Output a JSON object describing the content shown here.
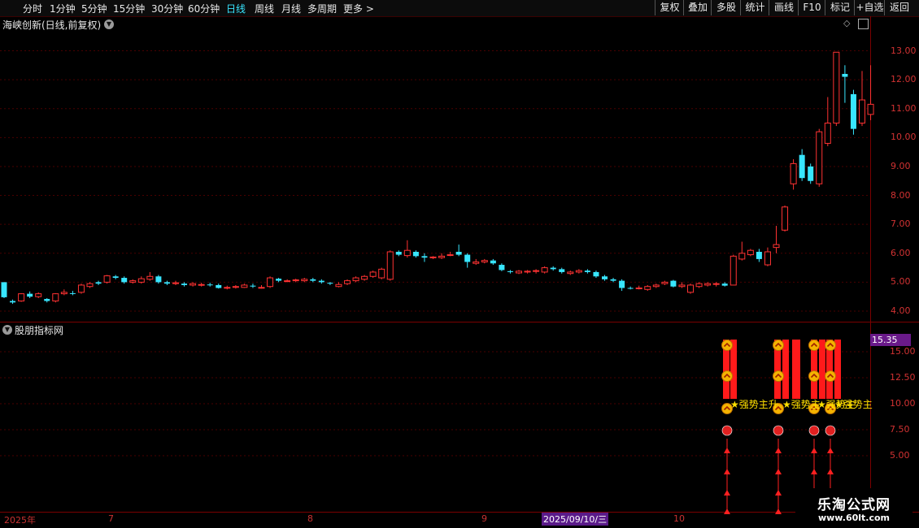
{
  "toolbar": {
    "left": [
      "分时",
      "1分钟",
      "5分钟",
      "15分钟",
      "30分钟",
      "60分钟",
      "日线",
      "周线",
      "月线",
      "多周期",
      "更多 >"
    ],
    "active": "日线",
    "right": [
      "复权",
      "叠加",
      "多股",
      "统计",
      "画线",
      "F10",
      "标记",
      "+自选",
      "返回"
    ]
  },
  "main_title": "海峡创新(日线,前复权)",
  "sub_title": "股朋指标网",
  "price_axis": [
    "13.00",
    "12.00",
    "11.00",
    "10.00",
    "9.00",
    "8.00",
    "7.00",
    "6.00",
    "5.00",
    "4.00"
  ],
  "indicator_axis": [
    "15.00",
    "12.50",
    "10.00",
    "7.50",
    "5.00"
  ],
  "indicator_current": "15.35",
  "date_axis": [
    "2025年",
    "7",
    "8",
    "9",
    "10"
  ],
  "selected_date": "2025/09/10/三",
  "signals": [
    {
      "label": "★强势主升"
    },
    {
      "label": "★强势主"
    },
    {
      "label": "★强势主"
    },
    {
      "label": "★强势主"
    }
  ],
  "watermark": {
    "line1": "乐淘公式网",
    "line2": "www.60lt.com"
  },
  "colors": {
    "up": "#ff3232",
    "down": "#38e6ff",
    "bar": "#ff1a1a",
    "signal_text": "#ffe000",
    "axis": "#d23232"
  },
  "chart_data": {
    "type": "candlestick",
    "ylim": [
      3.8,
      13.6
    ],
    "candles": [
      [
        5.0,
        4.48,
        5.0,
        4.45
      ],
      [
        4.35,
        4.3,
        4.4,
        4.25
      ],
      [
        4.35,
        4.6,
        4.62,
        4.32
      ],
      [
        4.6,
        4.5,
        4.68,
        4.45
      ],
      [
        4.5,
        4.6,
        4.65,
        4.45
      ],
      [
        4.42,
        4.35,
        4.45,
        4.3
      ],
      [
        4.35,
        4.6,
        4.62,
        4.3
      ],
      [
        4.6,
        4.65,
        4.75,
        4.55
      ],
      [
        4.62,
        4.6,
        4.7,
        4.55
      ],
      [
        4.65,
        4.9,
        4.95,
        4.6
      ],
      [
        4.85,
        4.95,
        5.0,
        4.8
      ],
      [
        5.0,
        4.95,
        5.05,
        4.9
      ],
      [
        5.0,
        5.22,
        5.25,
        4.95
      ],
      [
        5.2,
        5.15,
        5.25,
        5.1
      ],
      [
        5.15,
        5.0,
        5.2,
        4.95
      ],
      [
        5.0,
        5.05,
        5.1,
        4.95
      ],
      [
        5.0,
        5.12,
        5.2,
        4.95
      ],
      [
        5.1,
        5.2,
        5.35,
        5.05
      ],
      [
        5.2,
        5.0,
        5.25,
        4.95
      ],
      [
        5.0,
        4.95,
        5.05,
        4.9
      ],
      [
        4.95,
        4.98,
        5.05,
        4.9
      ],
      [
        4.95,
        4.9,
        5.0,
        4.85
      ],
      [
        4.9,
        4.95,
        5.0,
        4.85
      ],
      [
        4.9,
        4.92,
        4.98,
        4.85
      ],
      [
        4.92,
        4.9,
        4.98,
        4.85
      ],
      [
        4.9,
        4.8,
        4.95,
        4.78
      ],
      [
        4.8,
        4.82,
        4.88,
        4.75
      ],
      [
        4.82,
        4.85,
        4.9,
        4.78
      ],
      [
        4.82,
        4.9,
        4.95,
        4.8
      ],
      [
        4.88,
        4.85,
        4.95,
        4.8
      ],
      [
        4.8,
        4.82,
        4.9,
        4.78
      ],
      [
        4.85,
        5.15,
        5.2,
        4.8
      ],
      [
        5.12,
        5.05,
        5.15,
        5.0
      ],
      [
        5.05,
        5.05,
        5.1,
        5.0
      ],
      [
        5.05,
        5.08,
        5.12,
        5.0
      ],
      [
        5.05,
        5.1,
        5.15,
        5.0
      ],
      [
        5.1,
        5.05,
        5.15,
        5.0
      ],
      [
        5.05,
        5.0,
        5.1,
        4.95
      ],
      [
        4.98,
        4.95,
        5.0,
        4.9
      ],
      [
        4.85,
        4.92,
        5.0,
        4.82
      ],
      [
        4.95,
        5.05,
        5.1,
        4.9
      ],
      [
        5.05,
        5.15,
        5.2,
        5.0
      ],
      [
        5.1,
        5.2,
        5.25,
        5.05
      ],
      [
        5.2,
        5.35,
        5.4,
        5.15
      ],
      [
        5.15,
        5.45,
        5.5,
        5.1
      ],
      [
        5.1,
        6.05,
        6.1,
        5.05
      ],
      [
        6.05,
        5.95,
        6.1,
        5.9
      ],
      [
        5.92,
        6.1,
        6.45,
        5.85
      ],
      [
        6.05,
        5.9,
        6.1,
        5.85
      ],
      [
        5.9,
        5.85,
        6.0,
        5.7
      ],
      [
        5.85,
        5.87,
        5.9,
        5.8
      ],
      [
        5.85,
        5.9,
        6.0,
        5.8
      ],
      [
        5.95,
        5.95,
        6.05,
        5.9
      ],
      [
        6.05,
        5.95,
        6.3,
        5.9
      ],
      [
        5.95,
        5.7,
        6.0,
        5.5
      ],
      [
        5.65,
        5.7,
        5.8,
        5.6
      ],
      [
        5.7,
        5.75,
        5.8,
        5.65
      ],
      [
        5.75,
        5.65,
        5.8,
        5.6
      ],
      [
        5.6,
        5.42,
        5.65,
        5.38
      ],
      [
        5.38,
        5.35,
        5.42,
        5.3
      ],
      [
        5.32,
        5.38,
        5.42,
        5.28
      ],
      [
        5.35,
        5.38,
        5.42,
        5.3
      ],
      [
        5.38,
        5.4,
        5.45,
        5.3
      ],
      [
        5.35,
        5.5,
        5.55,
        5.3
      ],
      [
        5.5,
        5.45,
        5.55,
        5.4
      ],
      [
        5.45,
        5.35,
        5.5,
        5.3
      ],
      [
        5.3,
        5.35,
        5.4,
        5.25
      ],
      [
        5.35,
        5.4,
        5.45,
        5.3
      ],
      [
        5.4,
        5.35,
        5.45,
        5.3
      ],
      [
        5.35,
        5.2,
        5.4,
        5.15
      ],
      [
        5.2,
        5.1,
        5.25,
        5.05
      ],
      [
        5.1,
        5.05,
        5.15,
        5.0
      ],
      [
        5.05,
        4.8,
        5.1,
        4.7
      ],
      [
        4.8,
        4.78,
        4.85,
        4.75
      ],
      [
        4.8,
        4.8,
        4.88,
        4.75
      ],
      [
        4.75,
        4.85,
        4.9,
        4.7
      ],
      [
        4.85,
        4.9,
        4.95,
        4.8
      ],
      [
        4.95,
        5.0,
        5.05,
        4.9
      ],
      [
        5.05,
        4.85,
        5.08,
        4.82
      ],
      [
        4.85,
        4.9,
        5.0,
        4.8
      ],
      [
        4.65,
        4.9,
        4.95,
        4.6
      ],
      [
        4.85,
        4.95,
        5.0,
        4.8
      ],
      [
        4.9,
        4.95,
        5.0,
        4.85
      ],
      [
        4.95,
        4.95,
        5.0,
        4.85
      ],
      [
        4.95,
        4.88,
        5.0,
        4.85
      ],
      [
        4.9,
        5.9,
        5.95,
        4.9
      ],
      [
        5.8,
        6.0,
        6.4,
        5.75
      ],
      [
        5.95,
        6.1,
        6.15,
        5.9
      ],
      [
        6.05,
        5.8,
        6.15,
        5.7
      ],
      [
        5.6,
        6.05,
        6.2,
        5.55
      ],
      [
        6.2,
        6.3,
        6.95,
        6.0
      ],
      [
        6.8,
        7.6,
        7.65,
        6.75
      ],
      [
        8.4,
        9.1,
        9.25,
        8.2
      ],
      [
        9.4,
        8.6,
        9.6,
        8.5
      ],
      [
        9.0,
        8.5,
        9.1,
        8.4
      ],
      [
        8.4,
        10.2,
        10.3,
        8.3
      ],
      [
        9.8,
        10.5,
        11.4,
        9.7
      ],
      [
        10.5,
        12.95,
        12.95,
        10.4
      ],
      [
        12.2,
        12.1,
        12.5,
        11.2
      ],
      [
        11.5,
        10.3,
        11.65,
        10.1
      ],
      [
        10.5,
        11.3,
        12.3,
        10.4
      ],
      [
        10.8,
        11.15,
        12.5,
        10.6
      ]
    ]
  }
}
